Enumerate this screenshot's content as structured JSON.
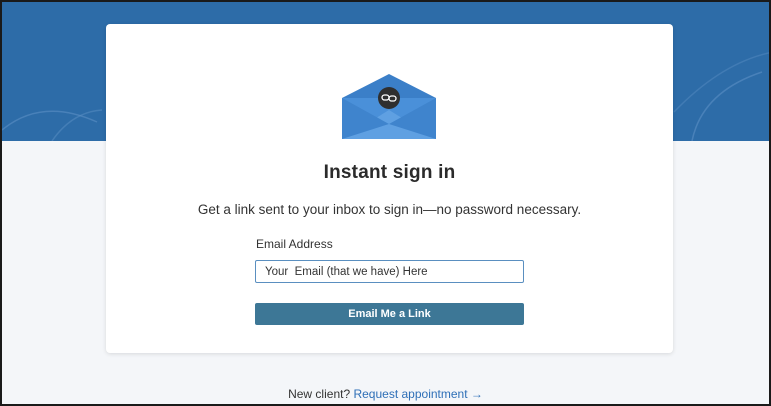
{
  "card": {
    "title": "Instant sign in",
    "subtitle": "Get a link sent to your inbox to sign in—no password necessary.",
    "email_label": "Email Address",
    "email_placeholder": "Your  Email (that we have) Here",
    "email_value": "",
    "submit_label": "Email Me a Link"
  },
  "footer": {
    "prompt": "New client?",
    "link_label": "Request appointment →"
  },
  "colors": {
    "hero": "#2d6ca8",
    "button": "#3d7796",
    "link": "#2e6fb7",
    "envelope": "#4a90d9"
  },
  "icons": {
    "envelope": "envelope-link-icon"
  }
}
